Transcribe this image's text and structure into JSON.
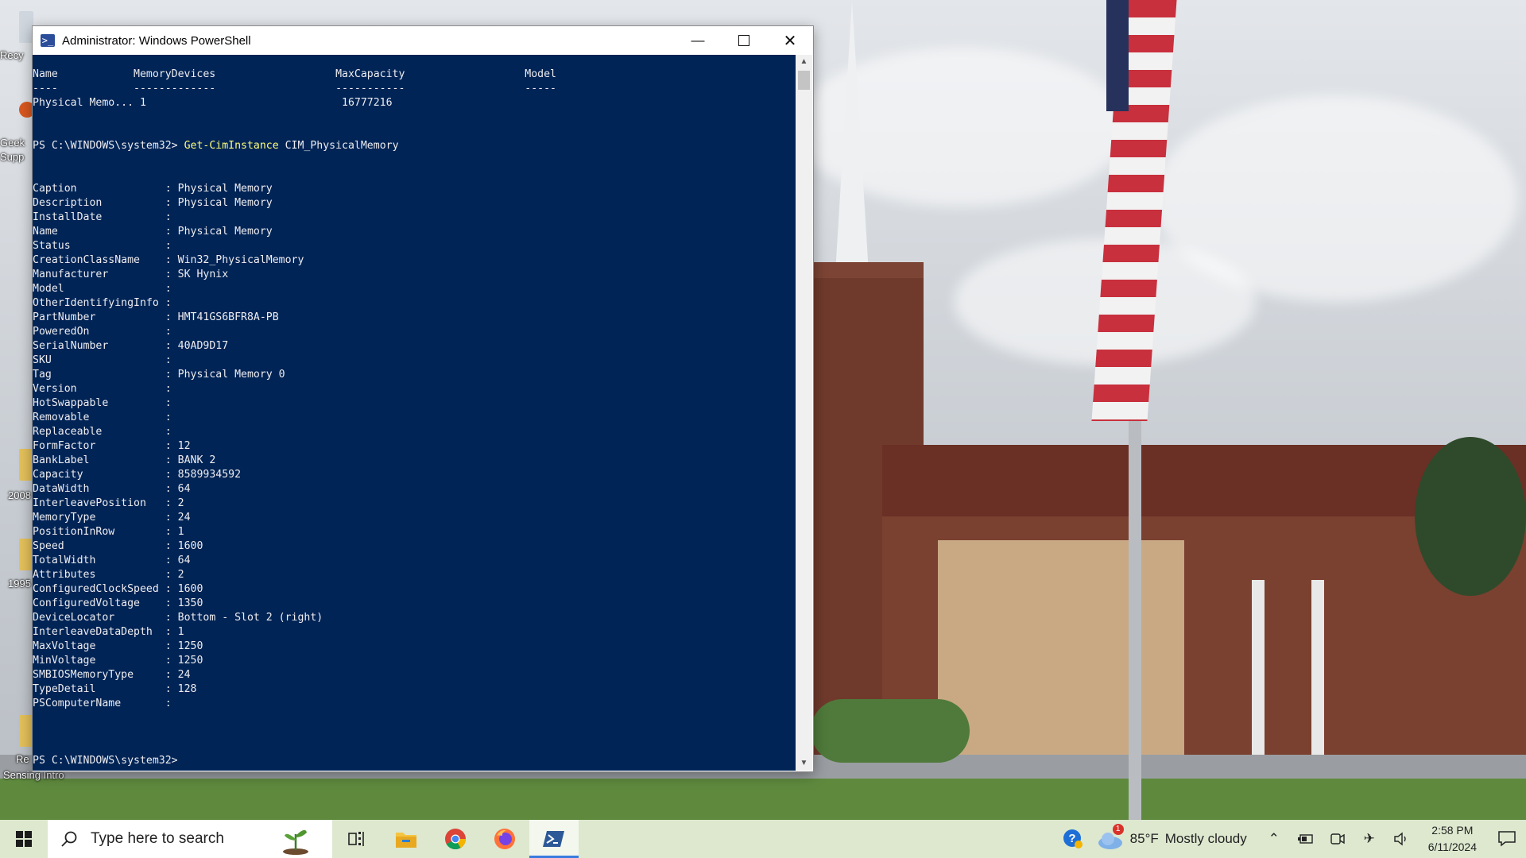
{
  "desktop": {
    "partial_labels": [
      "Recy",
      "Geek",
      "Supp",
      "2008",
      "1995",
      "Re",
      "Sensing Intro"
    ]
  },
  "window": {
    "title": "Administrator: Windows PowerShell",
    "minimize_icon": "minimize-icon",
    "maximize_icon": "maximize-icon",
    "close_icon": "close-icon"
  },
  "console": {
    "table_header": "Name            MemoryDevices                   MaxCapacity                   Model",
    "table_rule": "----            -------------                   -----------                   -----",
    "table_row": "Physical Memo... 1                               16777216",
    "prompt1": "PS C:\\WINDOWS\\system32> ",
    "command1": "Get-CimInstance",
    "command1_args": " CIM_PhysicalMemory",
    "properties": [
      {
        "k": "Caption",
        "v": "Physical Memory"
      },
      {
        "k": "Description",
        "v": "Physical Memory"
      },
      {
        "k": "InstallDate",
        "v": ""
      },
      {
        "k": "Name",
        "v": "Physical Memory"
      },
      {
        "k": "Status",
        "v": ""
      },
      {
        "k": "CreationClassName",
        "v": "Win32_PhysicalMemory"
      },
      {
        "k": "Manufacturer",
        "v": "SK Hynix"
      },
      {
        "k": "Model",
        "v": ""
      },
      {
        "k": "OtherIdentifyingInfo",
        "v": ""
      },
      {
        "k": "PartNumber",
        "v": "HMT41GS6BFR8A-PB"
      },
      {
        "k": "PoweredOn",
        "v": ""
      },
      {
        "k": "SerialNumber",
        "v": "40AD9D17"
      },
      {
        "k": "SKU",
        "v": ""
      },
      {
        "k": "Tag",
        "v": "Physical Memory 0"
      },
      {
        "k": "Version",
        "v": ""
      },
      {
        "k": "HotSwappable",
        "v": ""
      },
      {
        "k": "Removable",
        "v": ""
      },
      {
        "k": "Replaceable",
        "v": ""
      },
      {
        "k": "FormFactor",
        "v": "12"
      },
      {
        "k": "BankLabel",
        "v": "BANK 2"
      },
      {
        "k": "Capacity",
        "v": "8589934592"
      },
      {
        "k": "DataWidth",
        "v": "64"
      },
      {
        "k": "InterleavePosition",
        "v": "2"
      },
      {
        "k": "MemoryType",
        "v": "24"
      },
      {
        "k": "PositionInRow",
        "v": "1"
      },
      {
        "k": "Speed",
        "v": "1600"
      },
      {
        "k": "TotalWidth",
        "v": "64"
      },
      {
        "k": "Attributes",
        "v": "2"
      },
      {
        "k": "ConfiguredClockSpeed",
        "v": "1600"
      },
      {
        "k": "ConfiguredVoltage",
        "v": "1350"
      },
      {
        "k": "DeviceLocator",
        "v": "Bottom - Slot 2 (right)"
      },
      {
        "k": "InterleaveDataDepth",
        "v": "1"
      },
      {
        "k": "MaxVoltage",
        "v": "1250"
      },
      {
        "k": "MinVoltage",
        "v": "1250"
      },
      {
        "k": "SMBIOSMemoryType",
        "v": "24"
      },
      {
        "k": "TypeDetail",
        "v": "128"
      },
      {
        "k": "PSComputerName",
        "v": ""
      }
    ],
    "prompt2": "PS C:\\WINDOWS\\system32>"
  },
  "taskbar": {
    "search_placeholder": "Type here to search",
    "apps": [
      "task-view",
      "file-explorer",
      "chrome",
      "firefox",
      "powershell"
    ],
    "weather_temp": "85°F",
    "weather_desc": "Mostly cloudy",
    "weather_badge": "1",
    "time": "2:58 PM",
    "date": "6/11/2024"
  },
  "colors": {
    "console_bg": "#012456",
    "console_fg": "#eeedf0",
    "command": "#fdfd7a",
    "taskbar": "#dde8cf",
    "active_accent": "#3a7be0"
  }
}
